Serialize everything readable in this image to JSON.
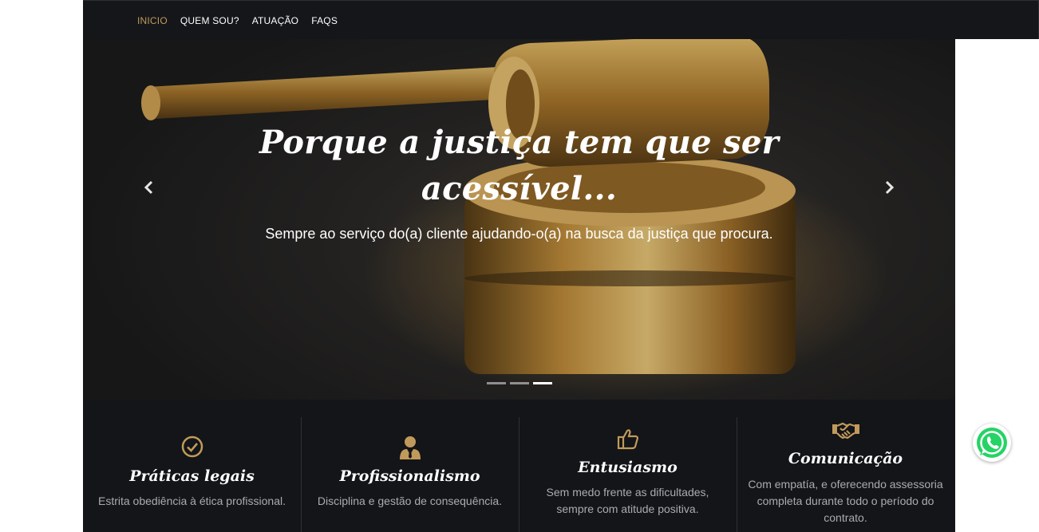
{
  "nav": {
    "items": [
      {
        "label": "INICIO",
        "active": true
      },
      {
        "label": "QUEM SOU?",
        "active": false
      },
      {
        "label": "ATUAÇÃO",
        "active": false
      },
      {
        "label": "FAQS",
        "active": false
      }
    ],
    "active_color": "#c19a5b"
  },
  "hero": {
    "title_line1": "Porque a justiça tem que ser",
    "title_line2": "acessível...",
    "subtitle": "Sempre ao serviço do(a) cliente ajudando-o(a) na busca da justiça que procura.",
    "prev_icon": "chevron-left-icon",
    "next_icon": "chevron-right-icon",
    "slides": 3,
    "active_slide": 3
  },
  "features": [
    {
      "icon": "check-circle-icon",
      "title": "Práticas legais",
      "lines": [
        "Estrita obediência à ética profissional."
      ]
    },
    {
      "icon": "user-tie-icon",
      "title": "Profissionalismo",
      "lines": [
        "Disciplina e gestão de consequência."
      ]
    },
    {
      "icon": "thumbs-up-icon",
      "title": "Entusiasmo",
      "lines": [
        "Sem medo frente as dificultades,",
        "sempre com atitude positiva."
      ]
    },
    {
      "icon": "handshake-icon",
      "title": "Comunicação",
      "lines": [
        "Com empatía, e oferecendo assessoria",
        "completa durante todo o período do",
        "contrato."
      ]
    }
  ],
  "whatsapp": {
    "icon": "whatsapp-icon",
    "color": "#25d366"
  },
  "accent_color": "#c19a5b"
}
